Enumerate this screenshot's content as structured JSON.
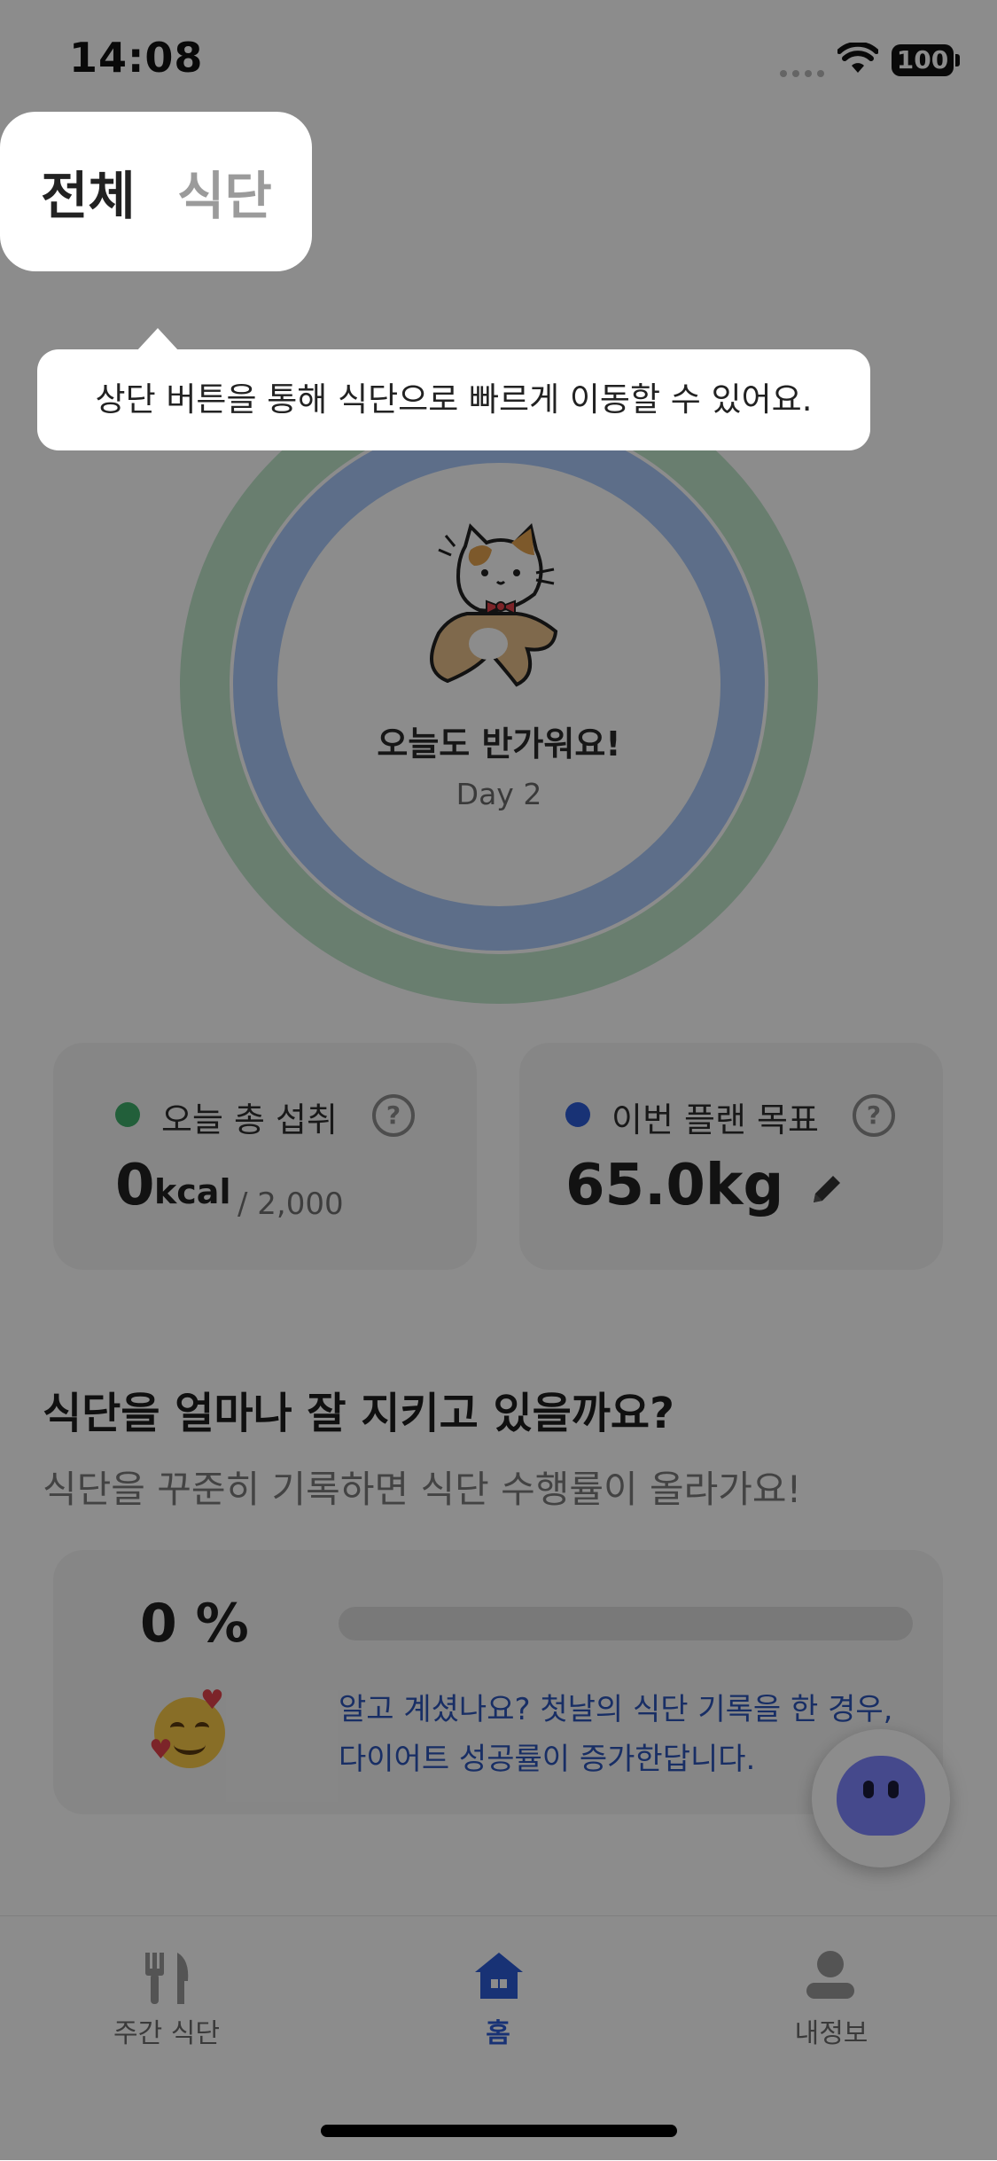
{
  "status_bar": {
    "time": "14:08",
    "battery": "100"
  },
  "header": {
    "tabs": [
      {
        "label": "전체"
      },
      {
        "label": "식단"
      }
    ]
  },
  "tooltip": {
    "text": "상단 버튼을 통해 식단으로 빠르게 이동할 수 있어요."
  },
  "main": {
    "greeting": "오늘도 반가워요!",
    "day": "Day 2",
    "intake_card": {
      "label": "오늘 총 섭취",
      "value": "0",
      "unit": "kcal",
      "target": "/ 2,000",
      "dot_color": "#3fae6a",
      "help": "?"
    },
    "goal_card": {
      "label": "이번 플랜 목표",
      "value": "65.0kg",
      "dot_color": "#2d5bd6",
      "help": "?"
    },
    "section_title": "식단을 얼마나 잘 지키고 있을까요?",
    "section_sub": "식단을 꾸준히 기록하면 식단 수행률이 올라가요!",
    "performance": {
      "percent": "0 %",
      "progress": 0.0,
      "tip_line1": "알고 계셨나요? 첫날의 식단 기록을 한 경우,",
      "tip_line2": "다이어트 성공률이 증가한답니다."
    }
  },
  "bottom_tabs": [
    {
      "label": "주간 식단",
      "icon": "fork-knife-icon"
    },
    {
      "label": "홈",
      "icon": "home-icon"
    },
    {
      "label": "내정보",
      "icon": "person-icon"
    }
  ],
  "colors": {
    "ring_outer": "#bfe6cb",
    "ring_inner": "#a9c8f9",
    "accent": "#2d5bd6",
    "tip_text": "#2c55b8"
  }
}
